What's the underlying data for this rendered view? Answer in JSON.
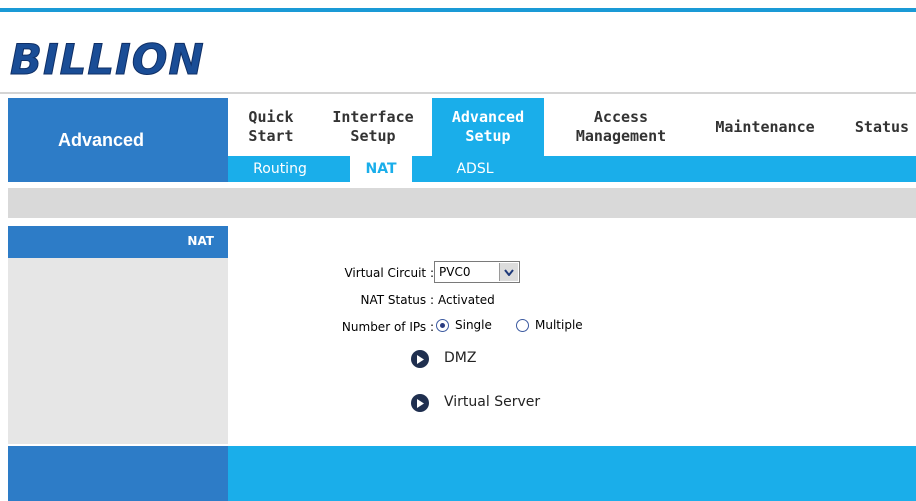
{
  "brand": {
    "logo_text": "BILLION"
  },
  "section": {
    "title": "Advanced"
  },
  "nav": {
    "tabs": [
      {
        "label": "Quick\nStart"
      },
      {
        "label": "Interface\nSetup"
      },
      {
        "label": "Advanced\nSetup"
      },
      {
        "label": "Access\nManagement"
      },
      {
        "label": "Maintenance"
      },
      {
        "label": "Status"
      }
    ],
    "active_tab": "Advanced\nSetup"
  },
  "subnav": {
    "items": [
      {
        "label": "Routing"
      },
      {
        "label": "NAT"
      },
      {
        "label": "ADSL"
      }
    ],
    "active": "NAT"
  },
  "sidebar": {
    "heading": "NAT"
  },
  "form": {
    "virtual_circuit_label": "Virtual Circuit :",
    "virtual_circuit_value": "PVC0",
    "nat_status_label": "NAT Status :",
    "nat_status_value": "Activated",
    "num_ips_label": "Number of IPs :",
    "num_ips_options": [
      {
        "label": "Single",
        "selected": true
      },
      {
        "label": "Multiple",
        "selected": false
      }
    ]
  },
  "links": {
    "dmz": "DMZ",
    "virtual_server": "Virtual Server"
  },
  "colors": {
    "accent_blue": "#1aaeea",
    "section_blue": "#2d7cc7",
    "sidebar_gray": "#e6e6e6"
  }
}
